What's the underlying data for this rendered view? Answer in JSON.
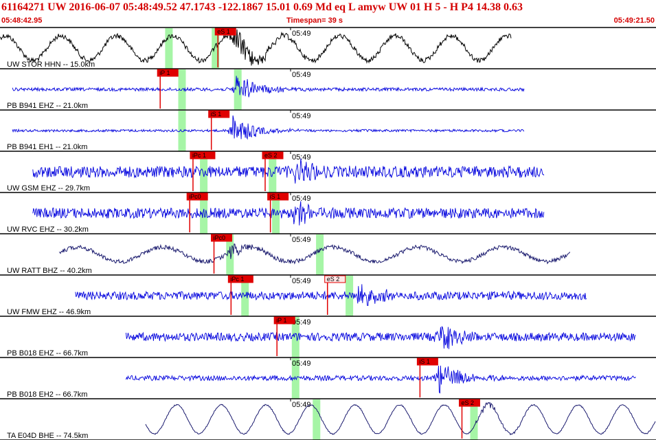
{
  "header": {
    "title": "61164271 UW 2016-06-07 05:48:49.52   47.1743 -122.1867  15.01  0.69 Md  eq  L amyw    UW 01  H   5  - H P4  14.38  0.63",
    "time_start": "05:48:42.95",
    "timespan": "Timespan=  39 s",
    "time_end": "05:49:21.50"
  },
  "colors": {
    "pick": "#e00000",
    "pick_text": "#000000",
    "band": "#a6f5a6",
    "trace_blue": "#0000dd",
    "trace_black": "#000000",
    "trace_navy": "#1a1a6e",
    "divider": "#000000"
  },
  "minute_label": "05:49",
  "traces": [
    {
      "label": "UW STOR HHN -- 15.0km",
      "color": "trace_black",
      "style": "wave",
      "start": 0.0,
      "end": 0.78,
      "amp": 0.6,
      "noise": 0.12,
      "period": 0.085,
      "event": 0.355,
      "event_amp": 0.9,
      "bands": [
        0.257,
        0.328
      ],
      "picks": [
        {
          "text": "eS 1",
          "at": 0.328,
          "filled": true
        }
      ]
    },
    {
      "label": "PB B941 EHZ -- 21.0km",
      "color": "trace_blue",
      "style": "noise",
      "start": 0.019,
      "end": 0.8,
      "amp": 0.0,
      "noise": 0.08,
      "period": 0.1,
      "event": 0.36,
      "event_amp": 0.75,
      "bands": [
        0.277,
        0.362
      ],
      "picks": [
        {
          "text": "iP 1",
          "at": 0.24,
          "filled": true
        }
      ]
    },
    {
      "label": "PB B941 EH1 -- 21.0km",
      "color": "trace_blue",
      "style": "noise",
      "start": 0.019,
      "end": 0.8,
      "amp": 0.0,
      "noise": 0.06,
      "period": 0.1,
      "event": 0.355,
      "event_amp": 0.85,
      "bands": [
        0.277
      ],
      "picks": [
        {
          "text": "iS 1",
          "at": 0.318,
          "filled": true
        }
      ]
    },
    {
      "label": "UW GSM EHZ -- 29.7km",
      "color": "trace_blue",
      "style": "noise",
      "start": 0.05,
      "end": 0.83,
      "amp": 0.0,
      "noise": 0.28,
      "period": 0.1,
      "event": 0.45,
      "event_amp": 0.55,
      "bands": [
        0.31,
        0.415
      ],
      "picks": [
        {
          "text": "iPc 1",
          "at": 0.29,
          "filled": true
        },
        {
          "text": "eS 2",
          "at": 0.4,
          "filled": true
        }
      ]
    },
    {
      "label": "UW RVC EHZ -- 30.2km",
      "color": "trace_blue",
      "style": "noise",
      "start": 0.05,
      "end": 0.83,
      "amp": 0.0,
      "noise": 0.25,
      "period": 0.1,
      "event": 0.445,
      "event_amp": 0.65,
      "bands": [
        0.31,
        0.42
      ],
      "picks": [
        {
          "text": "iPc0",
          "at": 0.285,
          "filled": true
        },
        {
          "text": "iS 1",
          "at": 0.408,
          "filled": true
        }
      ]
    },
    {
      "label": "UW RATT BHZ -- 40.2km",
      "color": "trace_navy",
      "style": "wave",
      "start": 0.09,
      "end": 0.87,
      "amp": 0.35,
      "noise": 0.1,
      "period": 0.13,
      "event": 0.35,
      "event_amp": 0.35,
      "bands": [
        0.35,
        0.487
      ],
      "picks": [
        {
          "text": "iPc0",
          "at": 0.322,
          "filled": true
        }
      ]
    },
    {
      "label": "UW FMW EHZ -- 46.9km",
      "color": "trace_blue",
      "style": "noise",
      "start": 0.115,
      "end": 0.895,
      "amp": 0.0,
      "noise": 0.2,
      "period": 0.1,
      "event": 0.545,
      "event_amp": 0.55,
      "bands": [
        0.373,
        0.532
      ],
      "picks": [
        {
          "text": "iPc 1",
          "at": 0.348,
          "filled": true
        },
        {
          "text": "eS 2",
          "at": 0.495,
          "filled": false
        }
      ]
    },
    {
      "label": "PB B018 EHZ -- 66.7km",
      "color": "trace_blue",
      "style": "noise",
      "start": 0.192,
      "end": 0.97,
      "amp": 0.0,
      "noise": 0.2,
      "period": 0.1,
      "event": 0.668,
      "event_amp": 0.75,
      "bands": [
        0.45
      ],
      "picks": [
        {
          "text": "iP 1",
          "at": 0.418,
          "filled": true
        }
      ]
    },
    {
      "label": "PB B018 EH2 -- 66.7km",
      "color": "trace_blue",
      "style": "noise",
      "start": 0.192,
      "end": 0.97,
      "amp": 0.0,
      "noise": 0.12,
      "period": 0.1,
      "event": 0.668,
      "event_amp": 0.85,
      "bands": [
        0.45
      ],
      "picks": [
        {
          "text": "iS 1",
          "at": 0.636,
          "filled": true
        }
      ]
    },
    {
      "label": "TA E04D BHE -- 74.5km",
      "color": "trace_navy",
      "style": "wave",
      "start": 0.222,
      "end": 1.0,
      "amp": 0.7,
      "noise": 0.03,
      "period": 0.068,
      "event": 0.73,
      "event_amp": 0.25,
      "bands": [
        0.482,
        0.722
      ],
      "picks": [
        {
          "text": "eS 2",
          "at": 0.7,
          "filled": true
        }
      ]
    }
  ]
}
